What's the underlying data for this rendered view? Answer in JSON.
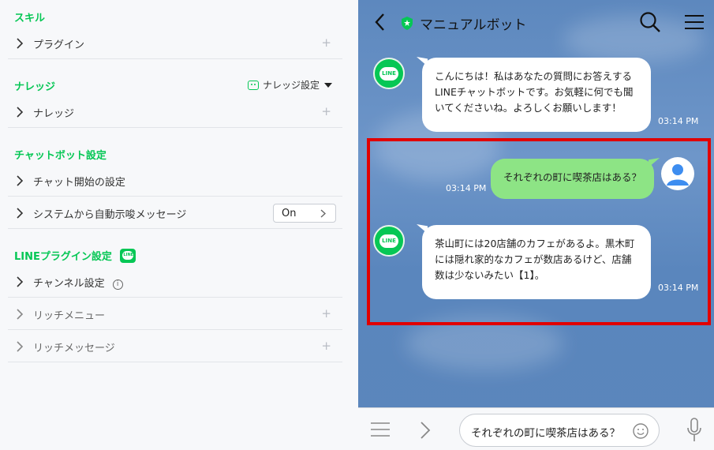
{
  "left": {
    "skill_title": "スキル",
    "plugin_label": "プラグイン",
    "knowledge_title": "ナレッジ",
    "knowledge_setting": "ナレッジ設定",
    "knowledge_label": "ナレッジ",
    "chatbot_title": "チャットボット設定",
    "chat_start": "チャット開始の設定",
    "system_suggest": "システムから自動示唆メッセージ",
    "system_suggest_value": "On",
    "line_plugin_title": "LINEプラグイン設定",
    "channel_setting": "チャンネル設定",
    "rich_menu": "リッチメニュー",
    "rich_message": "リッチメッセージ",
    "plus": "+",
    "info": "i"
  },
  "chat": {
    "title": "マニュアルボット",
    "avatar_text": "LINE",
    "messages": [
      {
        "text": "こんにちは！私はあなたの質問にお答えするLINEチャットボットです。お気軽に何でも聞いてくださいね。よろしくお願いします！",
        "time": "03:14 PM"
      },
      {
        "text": "それぞれの町に喫茶店はある？",
        "time": "03:14 PM"
      },
      {
        "text": "茶山町には20店舗のカフェがあるよ。黒木町には隠れ家的なカフェが数店あるけど、店舗数は少ないみたい【1】。",
        "time": "03:14 PM"
      }
    ],
    "input_value": "それぞれの町に喫茶店はある？"
  },
  "colors": {
    "accent": "#06c755",
    "outgoing": "#8de485",
    "highlight": "#e10000"
  }
}
